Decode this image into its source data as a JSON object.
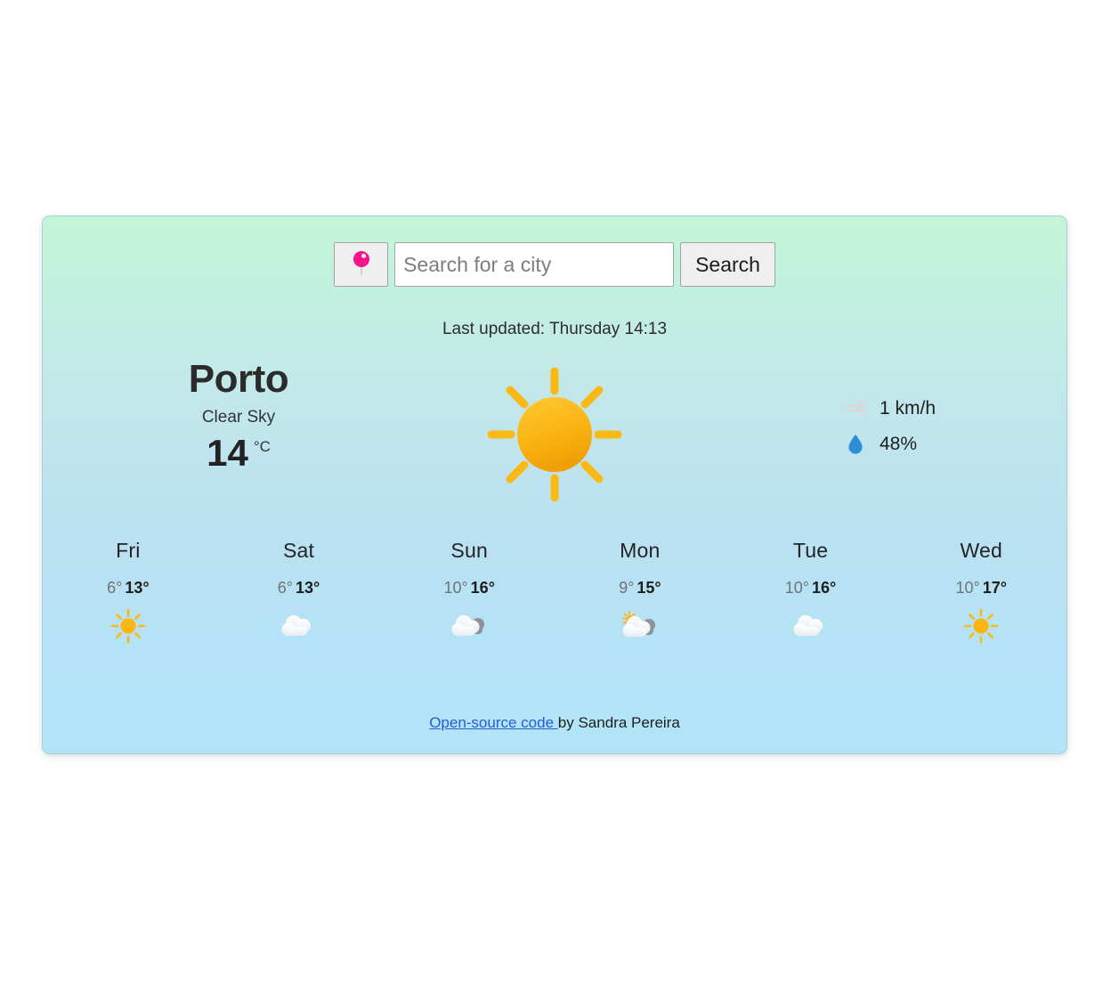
{
  "search": {
    "pin_icon": "location-pin-icon",
    "placeholder": "Search for a city",
    "value": "",
    "button_label": "Search"
  },
  "status": {
    "last_updated": "Last updated: Thursday 14:13"
  },
  "current": {
    "city": "Porto",
    "condition": "Clear Sky",
    "temperature": "14",
    "unit": "°C",
    "icon": "sun-icon",
    "wind": {
      "icon": "wind-icon",
      "value": "1 km/h"
    },
    "humidity": {
      "icon": "water-droplet-icon",
      "value": "48%"
    }
  },
  "forecast": [
    {
      "day": "Fri",
      "min": "6°",
      "max": "13°",
      "icon": "sun-icon"
    },
    {
      "day": "Sat",
      "min": "6°",
      "max": "13°",
      "icon": "cloud-icon"
    },
    {
      "day": "Sun",
      "min": "10°",
      "max": "16°",
      "icon": "cloud-behind-cloud-icon"
    },
    {
      "day": "Mon",
      "min": "9°",
      "max": "15°",
      "icon": "sun-behind-cloud-icon"
    },
    {
      "day": "Tue",
      "min": "10°",
      "max": "16°",
      "icon": "cloud-icon"
    },
    {
      "day": "Wed",
      "min": "10°",
      "max": "17°",
      "icon": "sun-icon"
    }
  ],
  "footer": {
    "link_text": "Open-source code ",
    "credit_text": "by Sandra Pereira"
  },
  "colors": {
    "card_top": "#c4f5d8",
    "card_bottom": "#b2e4f7",
    "sun": "#fbb915",
    "pin": "#f5148c",
    "droplet": "#2b8ed6",
    "link": "#2a5bd7"
  }
}
